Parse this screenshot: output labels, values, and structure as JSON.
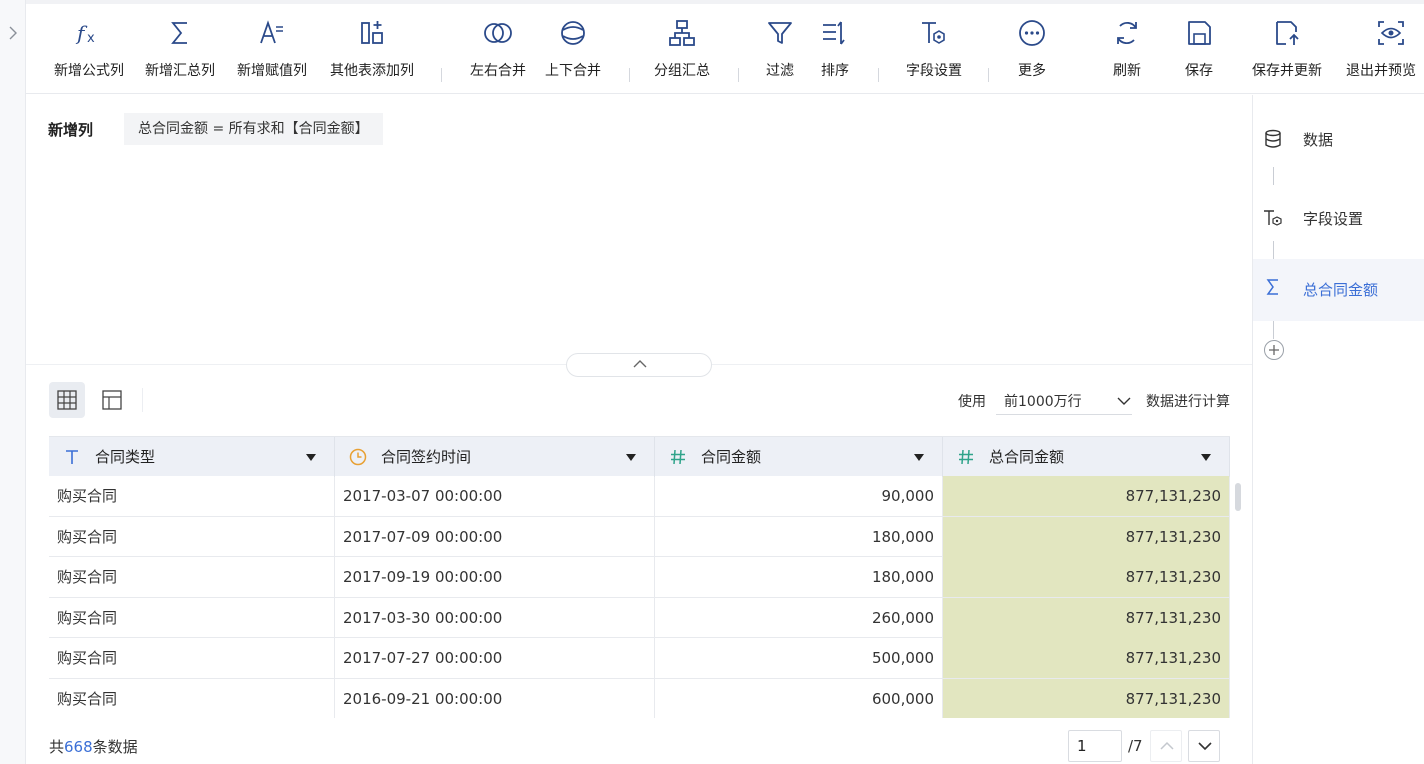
{
  "toolbar": {
    "items": [
      {
        "label": "新增公式列",
        "icon": "formula-fx-icon"
      },
      {
        "label": "新增汇总列",
        "icon": "sigma-icon"
      },
      {
        "label": "新增赋值列",
        "icon": "assign-column-icon"
      },
      {
        "label": "其他表添加列",
        "icon": "other-table-add-icon"
      },
      {
        "label": "左右合并",
        "icon": "merge-horizontal-icon"
      },
      {
        "label": "上下合并",
        "icon": "merge-vertical-icon"
      },
      {
        "label": "分组汇总",
        "icon": "group-summary-icon"
      },
      {
        "label": "过滤",
        "icon": "filter-icon"
      },
      {
        "label": "排序",
        "icon": "sort-icon"
      },
      {
        "label": "字段设置",
        "icon": "field-settings-icon"
      },
      {
        "label": "更多",
        "icon": "more-icon"
      },
      {
        "label": "刷新",
        "icon": "refresh-icon"
      },
      {
        "label": "保存",
        "icon": "save-icon"
      },
      {
        "label": "保存并更新",
        "icon": "save-update-icon"
      },
      {
        "label": "退出并预览",
        "icon": "exit-preview-icon"
      }
    ]
  },
  "formula": {
    "title": "新增列",
    "expression": "总合同金额 = 所有求和【合同金额】"
  },
  "calc": {
    "prefix": "使用",
    "selected": "前1000万行",
    "suffix": "数据进行计算"
  },
  "table": {
    "columns": [
      {
        "label": "合同类型",
        "type": "text"
      },
      {
        "label": "合同签约时间",
        "type": "date"
      },
      {
        "label": "合同金额",
        "type": "number"
      },
      {
        "label": "总合同金额",
        "type": "number"
      }
    ],
    "rows": [
      [
        "购买合同",
        "2017-03-07 00:00:00",
        "90,000",
        "877,131,230"
      ],
      [
        "购买合同",
        "2017-07-09 00:00:00",
        "180,000",
        "877,131,230"
      ],
      [
        "购买合同",
        "2017-09-19 00:00:00",
        "180,000",
        "877,131,230"
      ],
      [
        "购买合同",
        "2017-03-30 00:00:00",
        "260,000",
        "877,131,230"
      ],
      [
        "购买合同",
        "2017-07-27 00:00:00",
        "500,000",
        "877,131,230"
      ],
      [
        "购买合同",
        "2016-09-21 00:00:00",
        "600,000",
        "877,131,230"
      ]
    ],
    "highlight_color": "#e2e6c0"
  },
  "footer": {
    "prefix": "共",
    "count": "668",
    "suffix": "条数据",
    "page": "1",
    "total_pages": "/7"
  },
  "steps": [
    {
      "label": "数据",
      "icon": "database-icon"
    },
    {
      "label": "字段设置",
      "icon": "field-settings-icon"
    },
    {
      "label": "总合同金额",
      "icon": "sigma-icon",
      "active": true
    }
  ],
  "colors": {
    "accent": "#3b6fd6",
    "icon": "#2b4a8a",
    "date_icon": "#e8a033",
    "number_icon": "#2fa38a"
  }
}
